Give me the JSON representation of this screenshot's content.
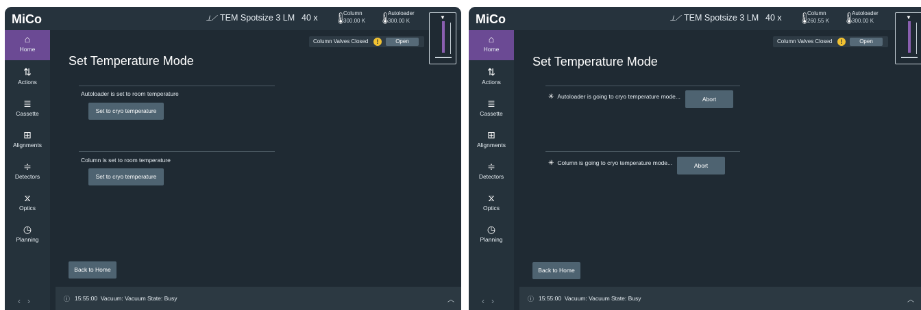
{
  "app": {
    "brand": "MiCo"
  },
  "topbar": {
    "mode": "TEM  Spotsize 3  LM",
    "magnification": "40 x",
    "column_label": "Column",
    "autoloader_label": "Autoloader"
  },
  "nav": {
    "items": [
      {
        "label": "Home",
        "icon": "home-icon"
      },
      {
        "label": "Actions",
        "icon": "refresh-icon"
      },
      {
        "label": "Cassette",
        "icon": "cassette-icon"
      },
      {
        "label": "Alignments",
        "icon": "alignments-icon"
      },
      {
        "label": "Detectors",
        "icon": "detectors-icon"
      },
      {
        "label": "Optics",
        "icon": "optics-icon"
      },
      {
        "label": "Planning",
        "icon": "clock-icon"
      }
    ],
    "active": "Home",
    "back_arrow": "‹",
    "forward_arrow": "›"
  },
  "valves": {
    "text": "Column Valves Closed",
    "warn": "!",
    "button": "Open"
  },
  "page": {
    "title": "Set Temperature Mode",
    "back_button": "Back to Home"
  },
  "footer": {
    "time": "15:55:00",
    "message": "Vacuum: Vacuum State: Busy"
  },
  "left": {
    "column_temp": "300.00 K",
    "autoloader_temp": "300.00 K",
    "autoloader_status": "Autoloader is set to room temperature",
    "autoloader_button": "Set to cryo temperature",
    "column_status": "Column is set to room temperature",
    "column_button": "Set to cryo temperature"
  },
  "right": {
    "column_temp": "260.55 K",
    "autoloader_temp": "300.00 K",
    "autoloader_status": "Autoloader is going to cryo temperature mode...",
    "autoloader_button": "Abort",
    "column_status": "Column is going to cryo temperature mode...",
    "column_button": "Abort"
  },
  "colors": {
    "background": "#1f2a33",
    "active_nav": "#6b4a94",
    "button": "#4e6371",
    "warning": "#f1c232"
  }
}
